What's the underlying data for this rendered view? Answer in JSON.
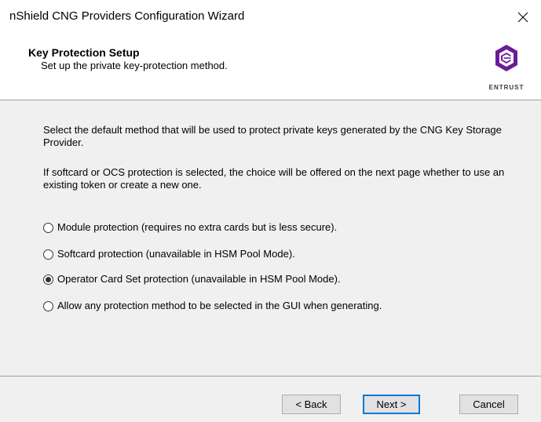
{
  "window": {
    "title": "nShield CNG Providers Configuration Wizard",
    "close_icon": "close-icon"
  },
  "header": {
    "title": "Key Protection Setup",
    "subtitle": "Set up the private key-protection method.",
    "logo_text": "ENTRUST",
    "logo_icon": "entrust-logo-icon"
  },
  "content": {
    "paragraph1": "Select the default method that will be used to protect private keys generated by the CNG Key Storage Provider.",
    "paragraph2": "If softcard or OCS protection is selected, the choice will be offered on the next page whether to use an existing token or create a new one.",
    "options": [
      {
        "label": "Module protection (requires no extra cards but is less secure).",
        "selected": false
      },
      {
        "label": "Softcard protection (unavailable in HSM Pool Mode).",
        "selected": false
      },
      {
        "label": "Operator Card Set protection (unavailable in HSM Pool Mode).",
        "selected": true
      },
      {
        "label": "Allow any protection method to be selected in the GUI when generating.",
        "selected": false
      }
    ]
  },
  "footer": {
    "back_label": "< Back",
    "next_label": "Next >",
    "cancel_label": "Cancel"
  },
  "colors": {
    "content_bg": "#f0f0f0",
    "focus_border": "#0078d7",
    "logo_purple": "#6b1b9a",
    "divider": "#a0a0a0"
  }
}
